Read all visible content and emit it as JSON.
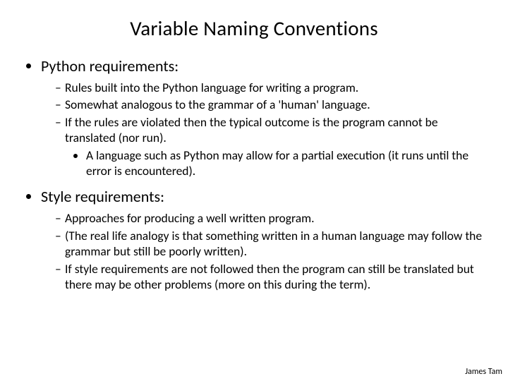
{
  "title": "Variable Naming Conventions",
  "sections": [
    {
      "heading": "Python requirements:",
      "items": [
        {
          "text": "Rules built into the Python language for writing a program."
        },
        {
          "text": "Somewhat analogous to the grammar of a 'human' language."
        },
        {
          "text": "If the rules are violated then the typical outcome is the program cannot be translated (nor run).",
          "subitems": [
            "A language such as Python may allow for a partial execution (it runs until the error is encountered)."
          ]
        }
      ]
    },
    {
      "heading": "Style requirements:",
      "items": [
        {
          "text": "Approaches for producing a well written program."
        },
        {
          "text": "(The real life analogy is that something written in a human language may follow the grammar but still be poorly written)."
        },
        {
          "text": "If style requirements are not followed then the program can still be translated but there may be other problems (more on this during the term)."
        }
      ]
    }
  ],
  "footer": "James Tam"
}
